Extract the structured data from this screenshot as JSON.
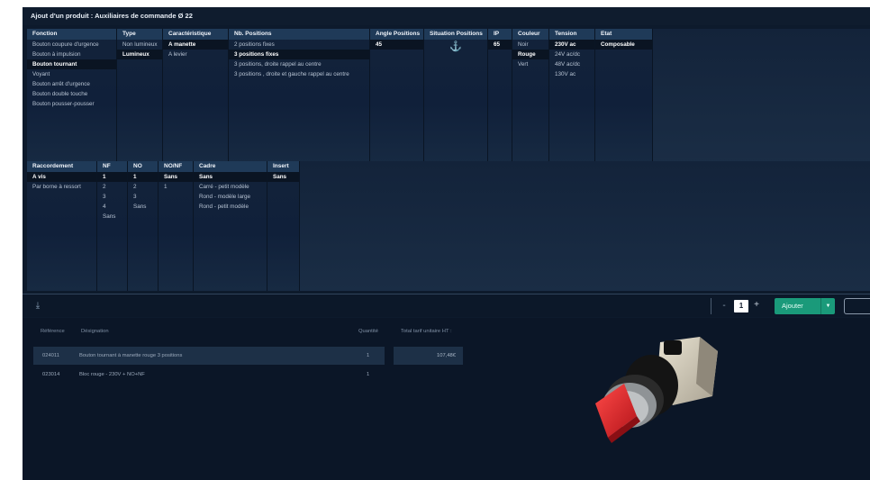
{
  "title": "Ajout d'un produit : Auxiliaires de commande Ø 22",
  "colors": {
    "background": "#0d1a2c",
    "header": "#1f3a58",
    "accent": "#1a9a7a",
    "product_red": "#e0262b"
  },
  "filters_top": {
    "columns": [
      {
        "header": "Fonction",
        "options": [
          {
            "label": "Bouton coupure d'urgence",
            "selected": false
          },
          {
            "label": "Bouton à impulsion",
            "selected": false
          },
          {
            "label": "Bouton tournant",
            "selected": true
          },
          {
            "label": "Voyant",
            "selected": false
          },
          {
            "label": "Bouton arrêt d'urgence",
            "selected": false
          },
          {
            "label": "Bouton double touche",
            "selected": false
          },
          {
            "label": "Bouton pousser-pousser",
            "selected": false
          }
        ]
      },
      {
        "header": "Type",
        "options": [
          {
            "label": "Non lumineux",
            "selected": false
          },
          {
            "label": "Lumineux",
            "selected": true
          }
        ]
      },
      {
        "header": "Caractéristique",
        "options": [
          {
            "label": "A manette",
            "selected": true
          },
          {
            "label": "A levier",
            "selected": false
          }
        ]
      },
      {
        "header": "Nb. Positions",
        "options": [
          {
            "label": "2 positions fixes",
            "selected": false
          },
          {
            "label": "3 positions fixes",
            "selected": true
          },
          {
            "label": "3 positions, droite rappel au centre",
            "selected": false
          },
          {
            "label": "3 positions , droite et gauche rappel au centre",
            "selected": false
          }
        ]
      },
      {
        "header": "Angle Positions",
        "options": [
          {
            "label": "45",
            "selected": true
          }
        ]
      },
      {
        "header": "Situation Positions",
        "options": [],
        "icon": "anchor-icon",
        "icon_glyph": "⚓"
      },
      {
        "header": "IP",
        "options": [
          {
            "label": "65",
            "selected": true
          }
        ]
      },
      {
        "header": "Couleur",
        "options": [
          {
            "label": "Noir",
            "selected": false
          },
          {
            "label": "Rouge",
            "selected": true
          },
          {
            "label": "Vert",
            "selected": false
          }
        ]
      },
      {
        "header": "Tension",
        "options": [
          {
            "label": "230V ac",
            "selected": true
          },
          {
            "label": "24V ac/dc",
            "selected": false
          },
          {
            "label": "48V ac/dc",
            "selected": false
          },
          {
            "label": "130V ac",
            "selected": false
          }
        ]
      },
      {
        "header": "Etat",
        "options": [
          {
            "label": "Composable",
            "selected": true
          }
        ]
      }
    ]
  },
  "filters_bottom": {
    "columns": [
      {
        "header": "Raccordement",
        "options": [
          {
            "label": "A vis",
            "selected": true
          },
          {
            "label": "Par borne à ressort",
            "selected": false
          }
        ]
      },
      {
        "header": "NF",
        "options": [
          {
            "label": "1",
            "selected": true
          },
          {
            "label": "2",
            "selected": false
          },
          {
            "label": "3",
            "selected": false
          },
          {
            "label": "4",
            "selected": false
          },
          {
            "label": "Sans",
            "selected": false
          }
        ]
      },
      {
        "header": "NO",
        "options": [
          {
            "label": "1",
            "selected": true
          },
          {
            "label": "2",
            "selected": false
          },
          {
            "label": "3",
            "selected": false
          },
          {
            "label": "Sans",
            "selected": false
          }
        ]
      },
      {
        "header": "NO/NF",
        "options": [
          {
            "label": "Sans",
            "selected": true
          },
          {
            "label": "1",
            "selected": false
          }
        ]
      },
      {
        "header": "Cadre",
        "options": [
          {
            "label": "Sans",
            "selected": true
          },
          {
            "label": "Carré - petit modèle",
            "selected": false
          },
          {
            "label": "Rond - modèle large",
            "selected": false
          },
          {
            "label": "Rond - petit modèle",
            "selected": false
          }
        ]
      },
      {
        "header": "Insert",
        "options": [
          {
            "label": "Sans",
            "selected": true
          }
        ]
      }
    ]
  },
  "toolbar": {
    "sort_icon": "sort-down-icon",
    "sort_glyph": "⤓",
    "minus": "-",
    "quantity": "1",
    "plus": "+",
    "add_label": "Ajouter",
    "add_caret": "▼"
  },
  "results": {
    "headers": {
      "reference": "Référence",
      "designation": "Désignation",
      "quantity": "Quantité",
      "total": "Total tarif unitaire HT :"
    },
    "rows": [
      {
        "reference": "024011",
        "designation": "Bouton tournant à manette rouge 3 positions",
        "quantity": "1",
        "highlighted": true
      },
      {
        "reference": "023014",
        "designation": "Bloc rouge - 230V + NO+NF",
        "quantity": "1",
        "highlighted": false
      }
    ],
    "total_price": "107,48€"
  }
}
